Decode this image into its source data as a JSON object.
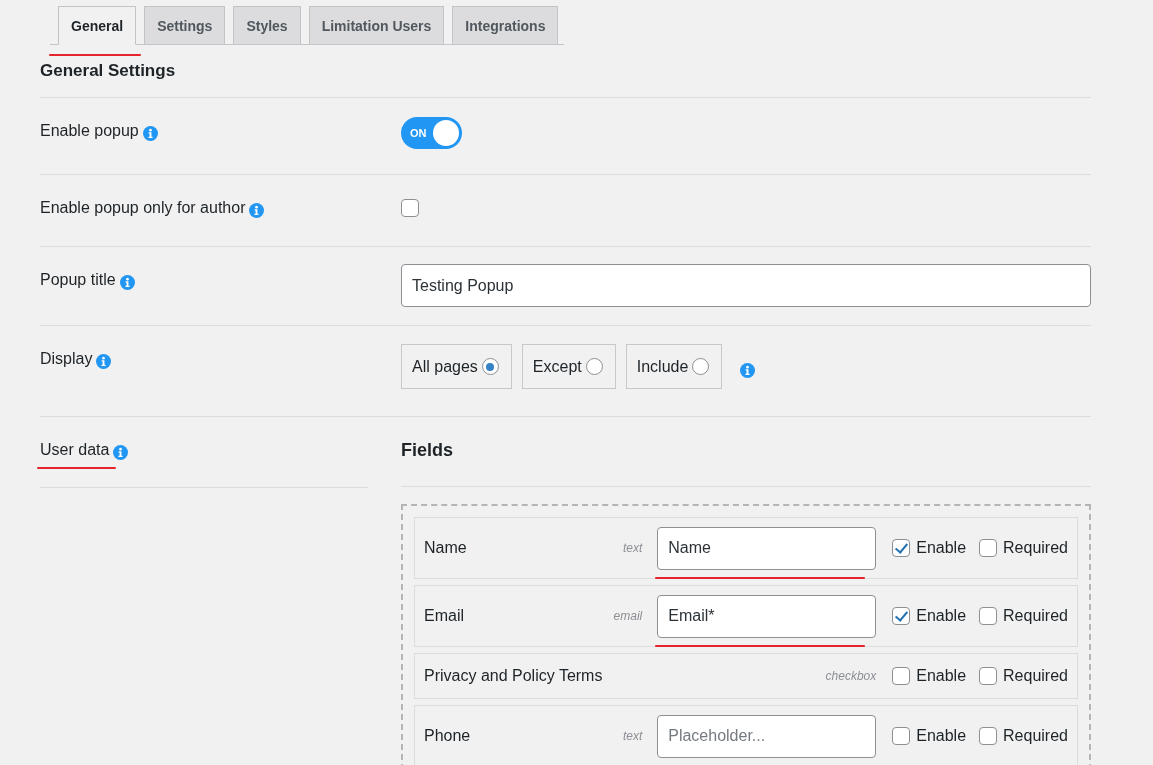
{
  "tabs": [
    {
      "label": "General",
      "selected": true,
      "underlined": true
    },
    {
      "label": "Settings",
      "selected": false,
      "underlined": false
    },
    {
      "label": "Styles",
      "selected": false,
      "underlined": false
    },
    {
      "label": "Limitation Users",
      "selected": false,
      "underlined": false
    },
    {
      "label": "Integrations",
      "selected": false,
      "underlined": false
    }
  ],
  "section_title": "General Settings",
  "settings": [
    {
      "kind": "toggle",
      "label": "Enable popup",
      "toggle": {
        "text": "ON",
        "on": true
      }
    },
    {
      "kind": "checkbox",
      "label": "Enable popup only for author",
      "checked": false
    },
    {
      "kind": "text",
      "label": "Popup title",
      "value": "Testing Popup"
    },
    {
      "kind": "radio",
      "label": "Display",
      "options": [
        {
          "label": "All pages",
          "selected": true
        },
        {
          "label": "Except",
          "selected": false
        },
        {
          "label": "Include",
          "selected": false
        }
      ]
    }
  ],
  "user_data": {
    "label": "User data",
    "underlined": true,
    "fields_title": "Fields",
    "fields": [
      {
        "kind": "input",
        "name": "Name",
        "type": "text",
        "value": "Name",
        "underlined": true,
        "enable": {
          "label": "Enable",
          "checked": true
        },
        "required": {
          "label": "Required",
          "checked": false
        }
      },
      {
        "kind": "input",
        "name": "Email",
        "type": "email",
        "value": "Email*",
        "underlined": true,
        "enable": {
          "label": "Enable",
          "checked": true
        },
        "required": {
          "label": "Required",
          "checked": false
        }
      },
      {
        "kind": "bare",
        "name": "Privacy and Policy Terms",
        "type": "checkbox",
        "enable": {
          "label": "Enable",
          "checked": false
        },
        "required": {
          "label": "Required",
          "checked": false
        }
      },
      {
        "kind": "input",
        "name": "Phone",
        "type": "text",
        "placeholder": "Placeholder...",
        "underlined": false,
        "enable": {
          "label": "Enable",
          "checked": false
        },
        "required": {
          "label": "Required",
          "checked": false
        }
      }
    ]
  }
}
